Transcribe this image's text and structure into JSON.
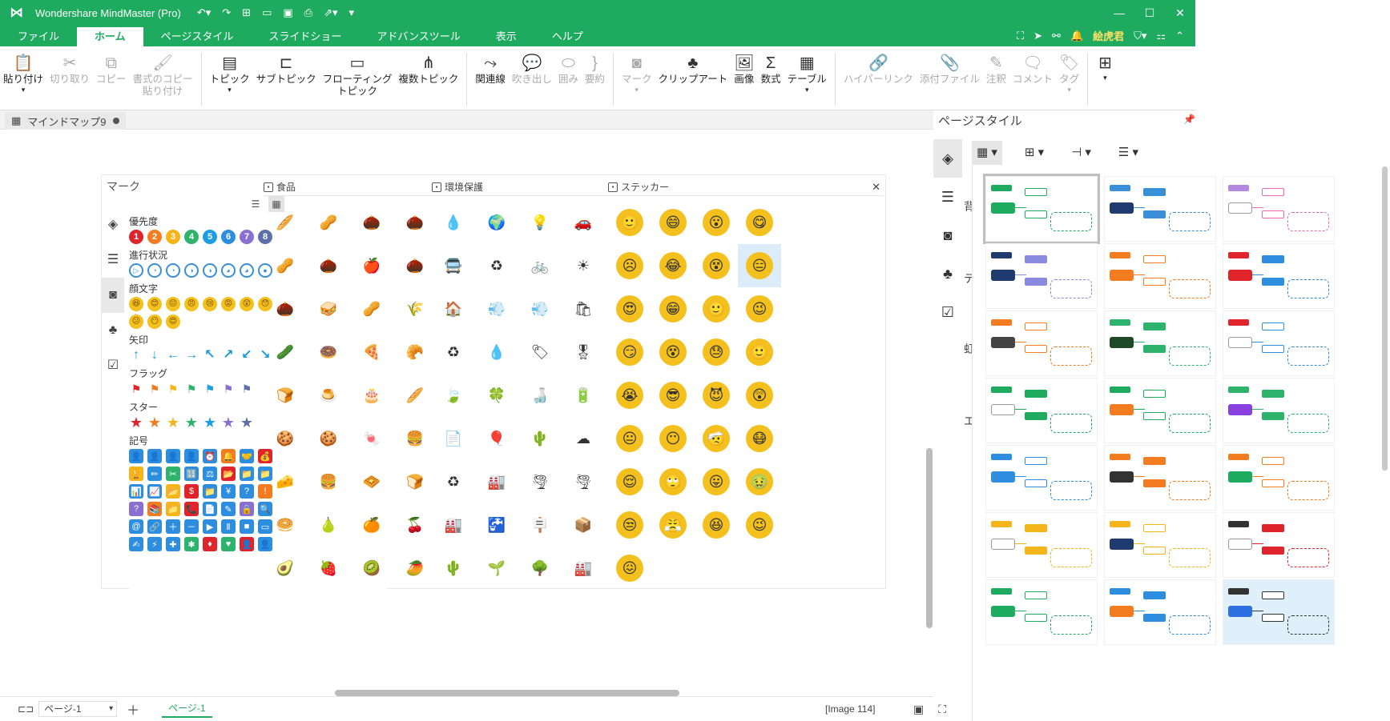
{
  "window": {
    "title": "Wondershare MindMaster (Pro)"
  },
  "menu": {
    "tabs": [
      "ファイル",
      "ホーム",
      "ページスタイル",
      "スライドショー",
      "アドバンスツール",
      "表示",
      "ヘルプ"
    ],
    "user": "絵虎君"
  },
  "ribbon": {
    "groups": [
      [
        {
          "label": "貼り付け",
          "icon": "paste",
          "disabled": false,
          "dd": true
        },
        {
          "label": "切り取り",
          "icon": "cut",
          "disabled": true
        },
        {
          "label": "コピー",
          "icon": "copy",
          "disabled": true
        },
        {
          "label": "書式のコピー\n貼り付け",
          "icon": "format-painter",
          "disabled": true
        }
      ],
      [
        {
          "label": "トピック",
          "icon": "topic",
          "disabled": false,
          "dd": true
        },
        {
          "label": "サブトピック",
          "icon": "subtopic",
          "disabled": false
        },
        {
          "label": "フローティング\nトピック",
          "icon": "floating-topic",
          "disabled": false
        },
        {
          "label": "複数トピック",
          "icon": "multiple-topic",
          "disabled": false
        }
      ],
      [
        {
          "label": "関連線",
          "icon": "relationship",
          "disabled": false
        },
        {
          "label": "吹き出し",
          "icon": "callout",
          "disabled": true
        },
        {
          "label": "囲み",
          "icon": "boundary",
          "disabled": true
        },
        {
          "label": "要約",
          "icon": "summary",
          "disabled": true
        }
      ],
      [
        {
          "label": "マーク",
          "icon": "mark",
          "disabled": true,
          "dd": true
        },
        {
          "label": "クリップアート",
          "icon": "clipart",
          "disabled": false
        },
        {
          "label": "画像",
          "icon": "image",
          "disabled": false
        },
        {
          "label": "数式",
          "icon": "formula",
          "disabled": false
        },
        {
          "label": "テーブル",
          "icon": "table",
          "disabled": false,
          "dd": true
        }
      ],
      [
        {
          "label": "ハイパーリンク",
          "icon": "hyperlink",
          "disabled": true
        },
        {
          "label": "添付ファイル",
          "icon": "attachment",
          "disabled": true
        },
        {
          "label": "注釈",
          "icon": "note",
          "disabled": true
        },
        {
          "label": "コメント",
          "icon": "comment",
          "disabled": true
        },
        {
          "label": "タグ",
          "icon": "tag",
          "disabled": true,
          "dd": true
        }
      ],
      [
        {
          "label": "",
          "icon": "layout",
          "disabled": false,
          "dd": true
        }
      ]
    ]
  },
  "doc": {
    "tab": "マインドマップ9"
  },
  "marks": {
    "title": "マーク",
    "sections": {
      "priority": {
        "title": "優先度",
        "items": [
          "1",
          "2",
          "3",
          "4",
          "5",
          "6",
          "7",
          "8"
        ],
        "colors": [
          "#e0242b",
          "#f47c20",
          "#f6b41b",
          "#2db36b",
          "#1d9ee0",
          "#2d8ee0",
          "#8a6fd1",
          "#5c6fa8"
        ]
      },
      "progress": {
        "title": "進行状況",
        "count": 8
      },
      "emoticon": {
        "title": "顔文字",
        "count": 11
      },
      "arrows": {
        "title": "矢印",
        "items": [
          "↑",
          "↓",
          "←",
          "→",
          "↖",
          "↗",
          "↙",
          "↘"
        ]
      },
      "flags": {
        "title": "フラッグ",
        "colors": [
          "#e0242b",
          "#f47c20",
          "#f6b41b",
          "#2db36b",
          "#1d9ee0",
          "#8a6fd1",
          "#5c6fa8"
        ]
      },
      "stars": {
        "title": "スター",
        "colors": [
          "#e0242b",
          "#f47c20",
          "#f6b41b",
          "#2db36b",
          "#1d9ee0",
          "#8a6fd1",
          "#5c6fa8"
        ]
      },
      "symbols": {
        "title": "記号",
        "count": 56
      }
    }
  },
  "clipart": {
    "food": {
      "title": "食品",
      "items": [
        "🥖",
        "🥜",
        "🌰",
        "🌰",
        "🥜",
        "🌰",
        "🍎",
        "🌰",
        "🌰",
        "🥪",
        "🥜",
        "🌾",
        "🥒",
        "🍩",
        "🍕",
        "🥐",
        "🍞",
        "🍮",
        "🎂",
        "🥖",
        "🍪",
        "🍪",
        "🍬",
        "🍔",
        "🧀",
        "🍔",
        "🧇",
        "🍞",
        "🥯",
        "🍐",
        "🍊",
        "🍒",
        "🥑",
        "🍓",
        "🥝",
        "🥭"
      ]
    },
    "eco": {
      "title": "環境保護",
      "items": [
        "💧",
        "🌍",
        "💡",
        "🚗",
        "🚍",
        "♻",
        "🚲",
        "☀",
        "🏠",
        "💨",
        "💨",
        "🛍",
        "♻",
        "💧",
        "🏷",
        "🎖",
        "🍃",
        "🍀",
        "🍶",
        "🔋",
        "📄",
        "🎈",
        "🌵",
        "☁",
        "♻",
        "🏭",
        "🌪",
        "🌪",
        "🏭",
        "🚰",
        "🪧",
        "📦",
        "🌵",
        "🌱",
        "🌳",
        "🏭"
      ]
    },
    "stickers": {
      "title": "ステッカー",
      "items": [
        "🙂",
        "😄",
        "😮",
        "😋",
        "☹",
        "😂",
        "😵",
        "😑",
        "😍",
        "😁",
        "🙂",
        "😉",
        "😏",
        "😵",
        "😓",
        "🙂",
        "😭",
        "😎",
        "😈",
        "😲",
        "😐",
        "😶",
        "🤕",
        "😷",
        "😌",
        "🙄",
        "😛",
        "🤢",
        "😒",
        "😤",
        "😆",
        "😉",
        "😖"
      ]
    }
  },
  "right": {
    "title": "ページスタイル",
    "side_labels": [
      "背",
      "テ",
      "虹",
      "エ"
    ],
    "templates": [
      {
        "main": "#1eab5f",
        "ft": "#1eab5f",
        "mt": "#1eab5f"
      },
      {
        "main": "#1e3a6e",
        "ft": "#3a8fd9",
        "mt": "#3a8fd9"
      },
      {
        "main": "#ffffff",
        "ft": "#b388e0",
        "mt": "#e86bb0"
      },
      {
        "main": "#1e3a6e",
        "ft": "#1e3a6e",
        "mt": "#8a8ae0"
      },
      {
        "main": "#f47c20",
        "ft": "#f47c20",
        "mt": "#f47c20"
      },
      {
        "main": "#e0242b",
        "ft": "#e0242b",
        "mt": "#2d8ee0"
      },
      {
        "main": "#444444",
        "ft": "#f47c20",
        "mt": "#f47c20"
      },
      {
        "main": "#1e4a2a",
        "ft": "#2db36b",
        "mt": "#2db36b"
      },
      {
        "main": "#ffffff",
        "ft": "#e0242b",
        "mt": "#2d8ee0"
      },
      {
        "main": "#ffffff",
        "ft": "#1eab5f",
        "mt": "#1eab5f"
      },
      {
        "main": "#f47c20",
        "ft": "#1eab5f",
        "mt": "#1eab5f"
      },
      {
        "main": "#8a3fe0",
        "ft": "#2db36b",
        "mt": "#2db36b"
      },
      {
        "main": "#2d8ee0",
        "ft": "#2d8ee0",
        "mt": "#2d8ee0"
      },
      {
        "main": "#333333",
        "ft": "#f47c20",
        "mt": "#f47c20"
      },
      {
        "main": "#1eab5f",
        "ft": "#f47c20",
        "mt": "#f47c20"
      },
      {
        "main": "#ffffff",
        "ft": "#f6b41b",
        "mt": "#f6b41b"
      },
      {
        "main": "#1e3a6e",
        "ft": "#f6b41b",
        "mt": "#f6b41b"
      },
      {
        "main": "#ffffff",
        "ft": "#333333",
        "mt": "#e0242b"
      },
      {
        "main": "#1eab5f",
        "ft": "#1eab5f",
        "mt": "#1eab5f"
      },
      {
        "main": "#f47c20",
        "ft": "#2d8ee0",
        "mt": "#2d8ee0"
      },
      {
        "main": "#2d6fe0",
        "ft": "#333333",
        "mt": "#333333"
      }
    ]
  },
  "status": {
    "page_select": "ページ-1",
    "page_tab": "ページ-1",
    "image_label": "[Image 114]"
  }
}
